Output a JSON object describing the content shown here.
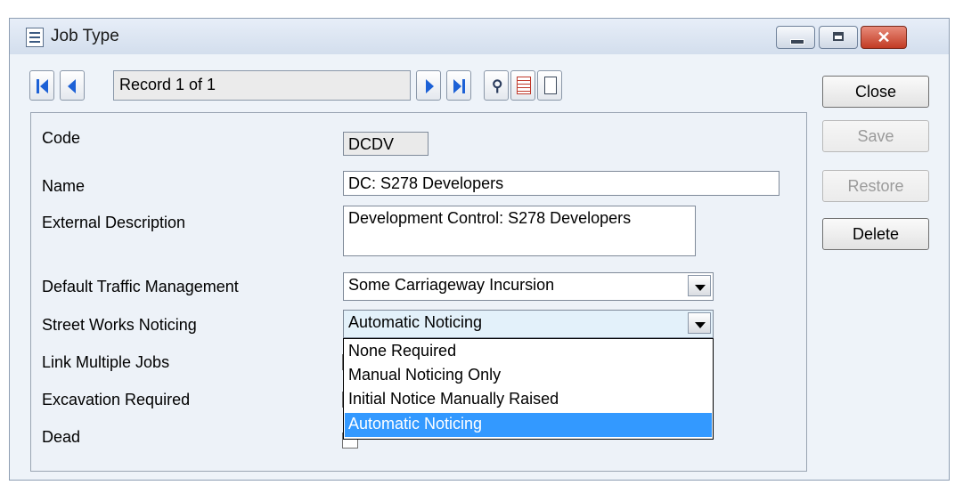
{
  "window": {
    "title": "Job Type",
    "close_glyph": "✕"
  },
  "navigation": {
    "record_text": "Record 1 of 1",
    "buttons": [
      "first-record-icon",
      "previous-record-icon",
      "next-record-icon",
      "last-record-icon",
      "find-binoculars-icon",
      "datasheet-view-icon",
      "form-view-icon"
    ],
    "binoculars_glyph": "⚲"
  },
  "actions": {
    "close": "Close",
    "save": "Save",
    "restore": "Restore",
    "delete": "Delete"
  },
  "form": {
    "code": {
      "label": "Code",
      "value": "DCDV"
    },
    "name": {
      "label": "Name",
      "value": "DC: S278 Developers"
    },
    "external_description": {
      "label": "External Description",
      "value": "Development Control: S278 Developers"
    },
    "default_traffic_management": {
      "label": "Default Traffic Management",
      "value": "Some Carriageway Incursion"
    },
    "street_works_noticing": {
      "label": "Street Works Noticing",
      "value": "Automatic Noticing"
    },
    "link_multiple_jobs": {
      "label": "Link Multiple Jobs"
    },
    "excavation_required": {
      "label": "Excavation Required"
    },
    "dead": {
      "label": "Dead"
    }
  },
  "dropdown": {
    "options": [
      "None Required",
      "Manual Noticing Only",
      "Initial Notice Manually Raised",
      "Automatic Noticing"
    ],
    "selected": "Automatic Noticing"
  },
  "colors": {
    "selection": "#3399ff",
    "nav_arrow": "#1d61d6",
    "close_button": "#c23b24"
  }
}
